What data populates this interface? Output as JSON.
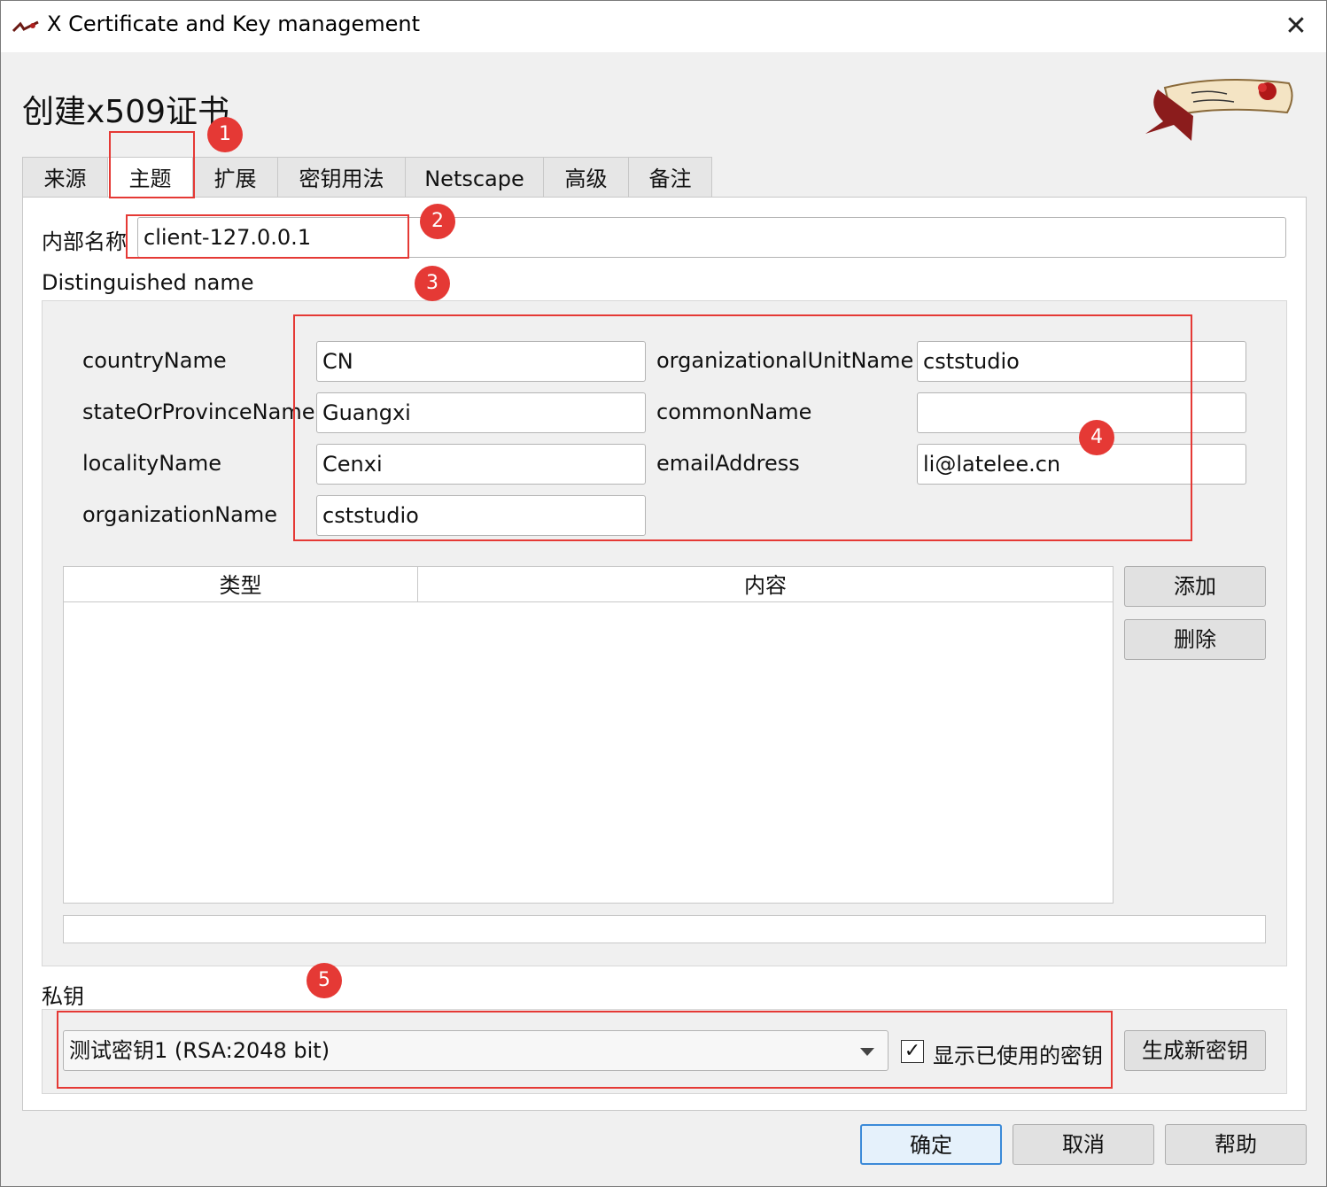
{
  "window": {
    "title": "X Certificate and Key management",
    "heading": "创建x509证书"
  },
  "tabs": [
    "来源",
    "主题",
    "扩展",
    "密钥用法",
    "Netscape",
    "高级",
    "备注"
  ],
  "internal_name": {
    "label": "内部名称",
    "value": "client-127.0.0.1"
  },
  "dn": {
    "group_label": "Distinguished name",
    "fields": {
      "countryName": {
        "label": "countryName",
        "value": "CN"
      },
      "stateOrProvinceName": {
        "label": "stateOrProvinceName",
        "value": "Guangxi"
      },
      "localityName": {
        "label": "localityName",
        "value": "Cenxi"
      },
      "organizationName": {
        "label": "organizationName",
        "value": "cststudio"
      },
      "organizationalUnitName": {
        "label": "organizationalUnitName",
        "value": "cststudio"
      },
      "commonName": {
        "label": "commonName",
        "value": ""
      },
      "emailAddress": {
        "label": "emailAddress",
        "value": "li@latelee.cn"
      }
    },
    "table_headers": [
      "类型",
      "内容"
    ],
    "add_button": "添加",
    "delete_button": "删除"
  },
  "private_key": {
    "label": "私钥",
    "selected": "测试密钥1 (RSA:2048 bit)",
    "show_used_checkbox": {
      "label": "显示已使用的密钥",
      "checked": true
    },
    "generate_button": "生成新密钥"
  },
  "footer": {
    "ok": "确定",
    "cancel": "取消",
    "help": "帮助"
  },
  "annotations": [
    "1",
    "2",
    "3",
    "4",
    "5"
  ],
  "colors": {
    "annotation": "#e53935",
    "default_button_border": "#3c8ad8"
  }
}
